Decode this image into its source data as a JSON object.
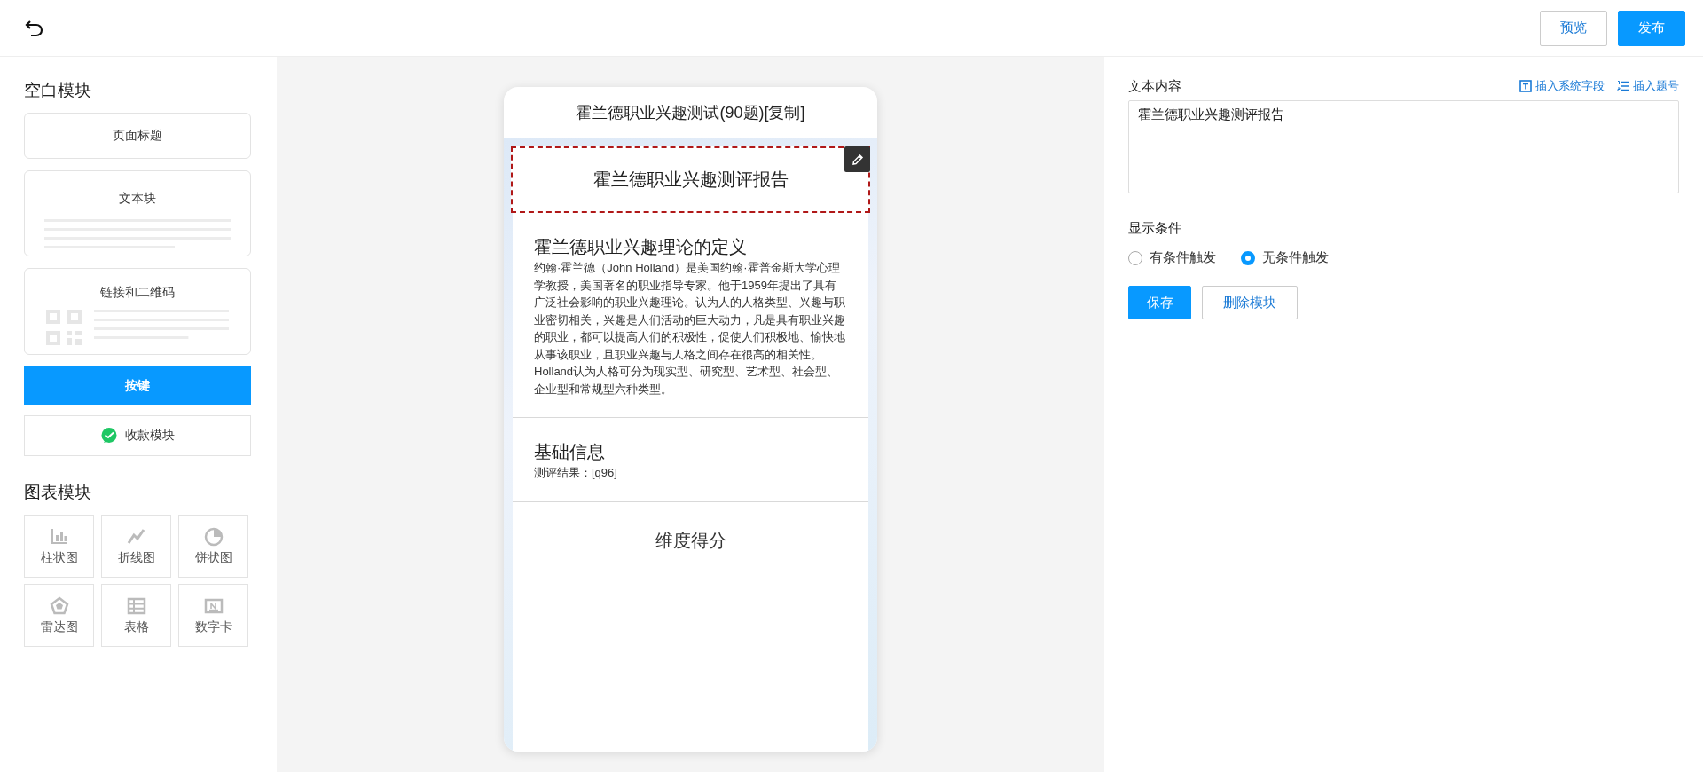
{
  "topbar": {
    "actions": [
      {
        "label": "预览",
        "kind": "outline"
      },
      {
        "label": "发布",
        "kind": "primary"
      }
    ]
  },
  "blank_modules": {
    "title": "空白模块",
    "items": [
      {
        "label": "页面标题",
        "kind": "title"
      },
      {
        "label": "文本块",
        "kind": "text"
      },
      {
        "label": "链接和二维码",
        "kind": "qr"
      },
      {
        "label": "按键",
        "kind": "button"
      },
      {
        "label": "收款模块",
        "kind": "pay"
      }
    ]
  },
  "chart_modules": {
    "title": "图表模块",
    "items": [
      {
        "label": "柱状图",
        "kind": "bar"
      },
      {
        "label": "折线图",
        "kind": "line"
      },
      {
        "label": "饼状图",
        "kind": "pie"
      },
      {
        "label": "雷达图",
        "kind": "radar"
      },
      {
        "label": "表格",
        "kind": "table"
      },
      {
        "label": "数字卡",
        "kind": "number"
      }
    ]
  },
  "preview": {
    "title": "霍兰德职业兴趣测试(90题)[复制]",
    "blocks": [
      {
        "kind": "report_title",
        "text": "霍兰德职业兴趣测评报告",
        "selected": true
      },
      {
        "kind": "text",
        "heading": "霍兰德职业兴趣理论的定义",
        "body": "约翰·霍兰德（John Holland）是美国约翰·霍普金斯大学心理学教授，美国著名的职业指导专家。他于1959年提出了具有广泛社会影响的职业兴趣理论。认为人的人格类型、兴趣与职业密切相关，兴趣是人们活动的巨大动力，凡是具有职业兴趣的职业，都可以提高人们的积极性，促使人们积极地、愉快地从事该职业，且职业兴趣与人格之间存在很高的相关性。Holland认为人格可分为现实型、研究型、艺术型、社会型、企业型和常规型六种类型。",
        "selected": false
      },
      {
        "kind": "text",
        "heading": "基础信息",
        "body": "测评结果：[q96]",
        "selected": false
      },
      {
        "kind": "chart_title",
        "text": "维度得分",
        "selected": false
      }
    ]
  },
  "settings": {
    "content_label": "文本内容",
    "insert_links": [
      {
        "label": "插入系统字段",
        "kind": "field"
      },
      {
        "label": "插入题号",
        "kind": "number"
      }
    ],
    "content_value": "霍兰德职业兴趣测评报告",
    "condition_label": "显示条件",
    "conditions": [
      {
        "label": "有条件触发",
        "selected": false
      },
      {
        "label": "无条件触发",
        "selected": true
      }
    ],
    "buttons": [
      {
        "label": "保存",
        "kind": "primary"
      },
      {
        "label": "删除模块",
        "kind": "outline"
      }
    ]
  }
}
